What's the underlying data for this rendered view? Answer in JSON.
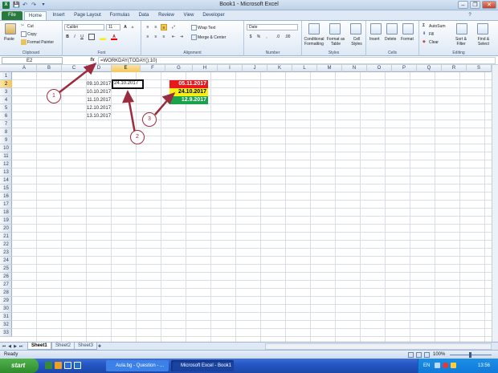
{
  "window": {
    "title": "Book1 - Microsoft Excel",
    "minimize": "–",
    "restore": "❐",
    "close": "✕"
  },
  "ribbon_tabs": [
    "File",
    "Home",
    "Insert",
    "Page Layout",
    "Formulas",
    "Data",
    "Review",
    "View",
    "Developer"
  ],
  "clipboard": {
    "paste": "Paste",
    "cut": "Cut",
    "copy": "Copy",
    "format_painter": "Format Painter",
    "label": "Clipboard"
  },
  "font": {
    "name": "Calibri",
    "size": "11",
    "grow": "A",
    "shrink": "A",
    "bold": "B",
    "italic": "I",
    "underline": "U",
    "label": "Font"
  },
  "alignment": {
    "wrap": "Wrap Text",
    "merge": "Merge & Center",
    "label": "Alignment"
  },
  "number": {
    "format": "Date",
    "currency": "$",
    "percent": "%",
    "comma": ",",
    "label": "Number"
  },
  "styles": {
    "conditional": "Conditional Formatting",
    "format_table": "Format as Table",
    "cell_styles": "Cell Styles",
    "label": "Styles"
  },
  "cells_group": {
    "insert": "Insert",
    "delete": "Delete",
    "format": "Format",
    "label": "Cells"
  },
  "editing": {
    "autosum": "AutoSum",
    "fill": "Fill",
    "clear": "Clear",
    "sort": "Sort & Filter",
    "find": "Find & Select",
    "label": "Editing"
  },
  "formula_bar": {
    "name_box": "E2",
    "fx": "fx",
    "formula": "=WORKDAY(TODAY();10)"
  },
  "columns": [
    "A",
    "B",
    "C",
    "D",
    "E",
    "F",
    "G",
    "H",
    "I",
    "J",
    "K",
    "L",
    "M",
    "N",
    "O",
    "P",
    "Q",
    "R",
    "S"
  ],
  "active_col": "E",
  "rows": [
    "1",
    "2",
    "3",
    "4",
    "5",
    "6",
    "7",
    "8",
    "9",
    "10",
    "11",
    "12",
    "13",
    "14",
    "15",
    "16",
    "17",
    "18",
    "19",
    "20",
    "21",
    "22",
    "23",
    "24",
    "25",
    "26",
    "27",
    "28",
    "29",
    "30",
    "31",
    "32",
    "33"
  ],
  "active_row": "2",
  "cells": {
    "d_values": [
      "09.10.2017",
      "10.10.2017",
      "11.10.2017",
      "12.10.2017",
      "13.10.2017"
    ],
    "e2": "24.10.2017",
    "g2": "05.11.2017",
    "g3": "24.10.2017",
    "g4": "12.9.2017"
  },
  "colors": {
    "g2_bg": "#e8191c",
    "g3_bg": "#f5ef16",
    "g4_bg": "#1aa34a",
    "callout": "#9b2b3e"
  },
  "callouts": [
    "1",
    "2",
    "3"
  ],
  "sheets": [
    "Sheet1",
    "Sheet2",
    "Sheet3"
  ],
  "status": {
    "ready": "Ready",
    "zoom": "100%"
  },
  "taskbar": {
    "start": "start",
    "tasks": [
      "Aula.bg - Question - ...",
      "Microsoft Excel - Book1"
    ],
    "lang": "EN",
    "time": "13:56"
  }
}
